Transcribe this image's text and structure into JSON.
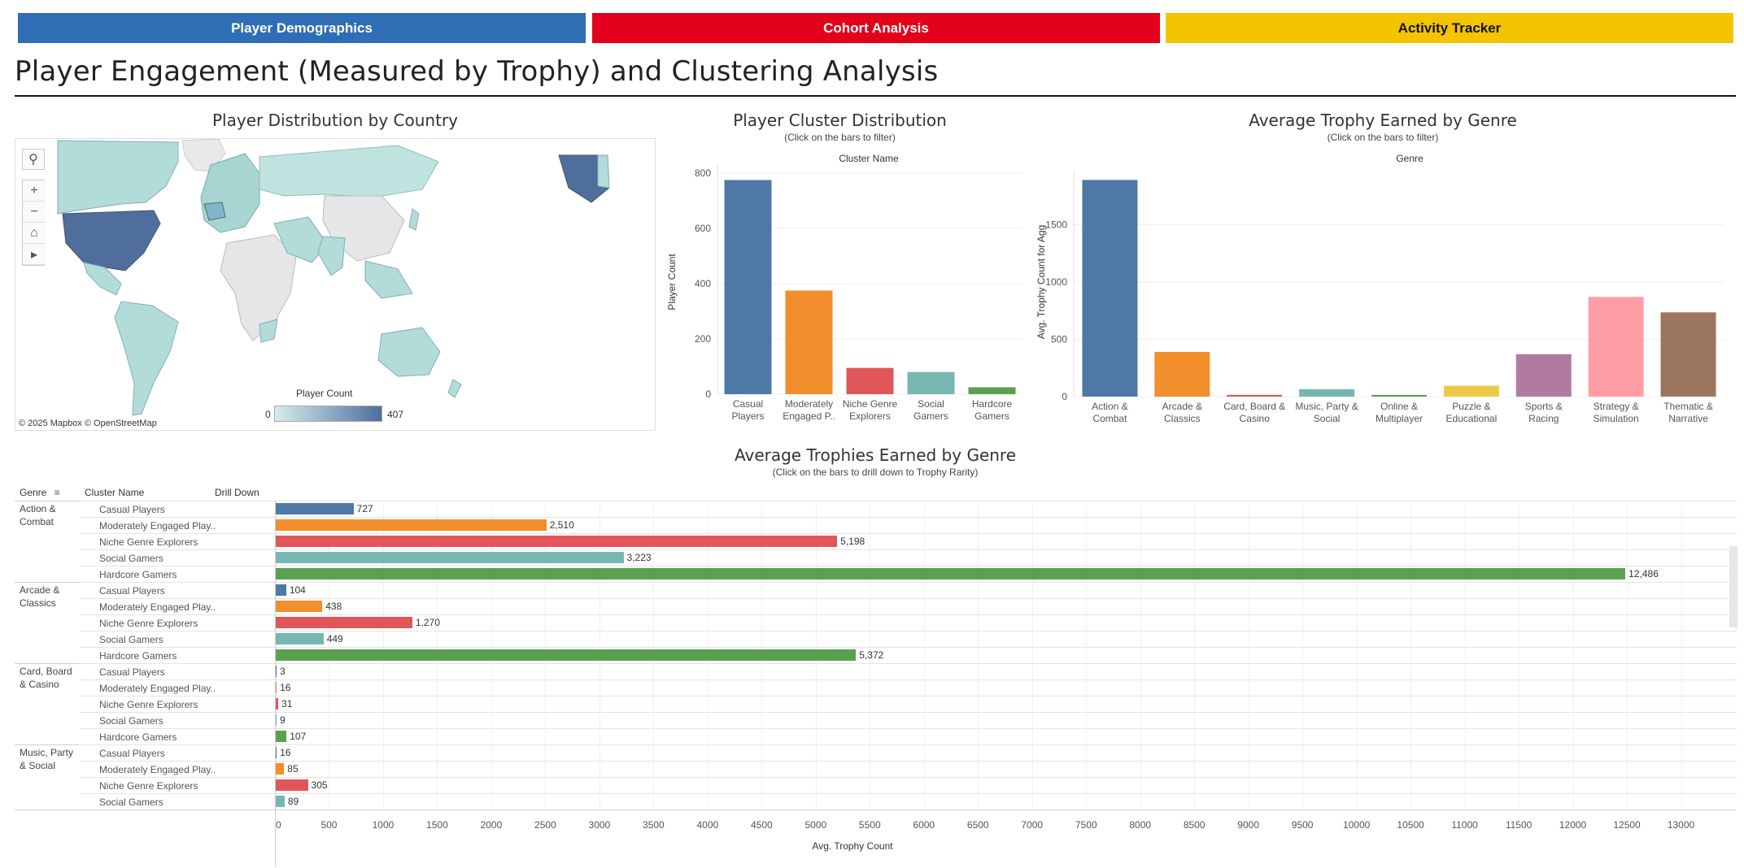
{
  "nav": [
    {
      "label": "Player Demographics",
      "color": "#2f6eb5"
    },
    {
      "label": "Cohort Analysis",
      "color": "#e3001b"
    },
    {
      "label": "Activity Tracker",
      "color": "#f5c400"
    }
  ],
  "page_title": "Player Engagement (Measured by Trophy) and Clustering Analysis",
  "map": {
    "title": "Player Distribution by Country",
    "legend_title": "Player Count",
    "legend_min": "0",
    "legend_max": "407",
    "attribution": "© 2025 Mapbox  © OpenStreetMap",
    "tools": [
      "search-icon",
      "zoom-in-icon",
      "zoom-out-icon",
      "home-icon",
      "play-icon"
    ]
  },
  "cluster_chart": {
    "title": "Player Cluster Distribution",
    "subtitle": "(Click on the bars to filter)",
    "header": "Cluster Name",
    "ylabel": "Player Count"
  },
  "genre_chart": {
    "title": "Average Trophy Earned by Genre",
    "subtitle": "(Click on the bars to filter)",
    "header": "Genre",
    "ylabel": "Avg. Trophy Count for Agg"
  },
  "drill": {
    "title": "Average Trophies Earned by Genre",
    "subtitle": "(Click on the bars to drill down to Trophy  Rarity)",
    "col_genre": "Genre",
    "col_cluster": "Cluster Name",
    "col_drill": "Drill Down",
    "xlabel": "Avg. Trophy Count"
  },
  "chart_data": [
    {
      "type": "bar",
      "title": "Player Cluster Distribution",
      "ylabel": "Player Count",
      "ylim": [
        0,
        800
      ],
      "yticks": [
        0,
        200,
        400,
        600,
        800
      ],
      "categories": [
        "Casual Players",
        "Moderately Engaged P..",
        "Niche Genre Explorers",
        "Social Gamers",
        "Hardcore Gamers"
      ],
      "category_lines": [
        [
          "Casual",
          "Players"
        ],
        [
          "Moderately",
          "Engaged P.."
        ],
        [
          "Niche Genre",
          "Explorers"
        ],
        [
          "Social",
          "Gamers"
        ],
        [
          "Hardcore",
          "Gamers"
        ]
      ],
      "values": [
        775,
        375,
        95,
        80,
        25
      ],
      "colors": [
        "#4e79a7",
        "#f28e2b",
        "#e15759",
        "#76b7b2",
        "#59a14f"
      ]
    },
    {
      "type": "bar",
      "title": "Average Trophy Earned by Genre",
      "ylabel": "Avg. Trophy Count for Agg",
      "ylim": [
        0,
        1900
      ],
      "yticks": [
        0,
        500,
        1000,
        1500
      ],
      "categories": [
        "Action & Combat",
        "Arcade & Classics",
        "Card, Board & Casino",
        "Music, Party & Social",
        "Online & Multiplayer",
        "Puzzle & Educational",
        "Sports & Racing",
        "Strategy & Simulation",
        "Thematic & Narrative"
      ],
      "category_lines": [
        [
          "Action &",
          "Combat"
        ],
        [
          "Arcade &",
          "Classics"
        ],
        [
          "Card, Board &",
          "Casino"
        ],
        [
          "Music, Party &",
          "Social"
        ],
        [
          "Online &",
          "Multiplayer"
        ],
        [
          "Puzzle &",
          "Educational"
        ],
        [
          "Sports &",
          "Racing"
        ],
        [
          "Strategy &",
          "Simulation"
        ],
        [
          "Thematic &",
          "Narrative"
        ]
      ],
      "values": [
        1890,
        390,
        15,
        65,
        15,
        95,
        370,
        870,
        735
      ],
      "colors": [
        "#4e79a7",
        "#f28e2b",
        "#e15759",
        "#76b7b2",
        "#59a14f",
        "#edc948",
        "#b07aa1",
        "#ff9da7",
        "#9c755f"
      ]
    },
    {
      "type": "bar",
      "orientation": "horizontal",
      "title": "Average Trophies Earned by Genre",
      "xlabel": "Avg. Trophy Count",
      "xlim": [
        0,
        13500
      ],
      "xticks": [
        0,
        500,
        1000,
        1500,
        2000,
        2500,
        3000,
        3500,
        4000,
        4500,
        5000,
        5500,
        6000,
        6500,
        7000,
        7500,
        8000,
        8500,
        9000,
        9500,
        10000,
        10500,
        11000,
        11500,
        12000,
        12500,
        13000
      ],
      "cluster_colors": {
        "Casual Players": "#4e79a7",
        "Moderately Engaged Play..": "#f28e2b",
        "Niche Genre Explorers": "#e15759",
        "Social Gamers": "#76b7b2",
        "Hardcore Gamers": "#59a14f"
      },
      "groups": [
        {
          "genre_lines": [
            "Action &",
            "Combat"
          ],
          "rows": [
            {
              "cluster": "Casual Players",
              "value": 727,
              "label": "727"
            },
            {
              "cluster": "Moderately Engaged Play..",
              "value": 2510,
              "label": "2,510"
            },
            {
              "cluster": "Niche Genre Explorers",
              "value": 5198,
              "label": "5,198"
            },
            {
              "cluster": "Social Gamers",
              "value": 3223,
              "label": "3,223"
            },
            {
              "cluster": "Hardcore Gamers",
              "value": 12486,
              "label": "12,486"
            }
          ]
        },
        {
          "genre_lines": [
            "Arcade &",
            "Classics"
          ],
          "rows": [
            {
              "cluster": "Casual Players",
              "value": 104,
              "label": "104"
            },
            {
              "cluster": "Moderately Engaged Play..",
              "value": 438,
              "label": "438"
            },
            {
              "cluster": "Niche Genre Explorers",
              "value": 1270,
              "label": "1,270"
            },
            {
              "cluster": "Social Gamers",
              "value": 449,
              "label": "449"
            },
            {
              "cluster": "Hardcore Gamers",
              "value": 5372,
              "label": "5,372"
            }
          ]
        },
        {
          "genre_lines": [
            "Card, Board",
            "& Casino"
          ],
          "rows": [
            {
              "cluster": "Casual Players",
              "value": 3,
              "label": "3"
            },
            {
              "cluster": "Moderately Engaged Play..",
              "value": 16,
              "label": "16"
            },
            {
              "cluster": "Niche Genre Explorers",
              "value": 31,
              "label": "31"
            },
            {
              "cluster": "Social Gamers",
              "value": 9,
              "label": "9"
            },
            {
              "cluster": "Hardcore Gamers",
              "value": 107,
              "label": "107"
            }
          ]
        },
        {
          "genre_lines": [
            "Music, Party",
            "& Social"
          ],
          "rows": [
            {
              "cluster": "Casual Players",
              "value": 16,
              "label": "16"
            },
            {
              "cluster": "Moderately Engaged Play..",
              "value": 85,
              "label": "85"
            },
            {
              "cluster": "Niche Genre Explorers",
              "value": 305,
              "label": "305"
            },
            {
              "cluster": "Social Gamers",
              "value": 89,
              "label": "89"
            }
          ]
        }
      ]
    }
  ]
}
